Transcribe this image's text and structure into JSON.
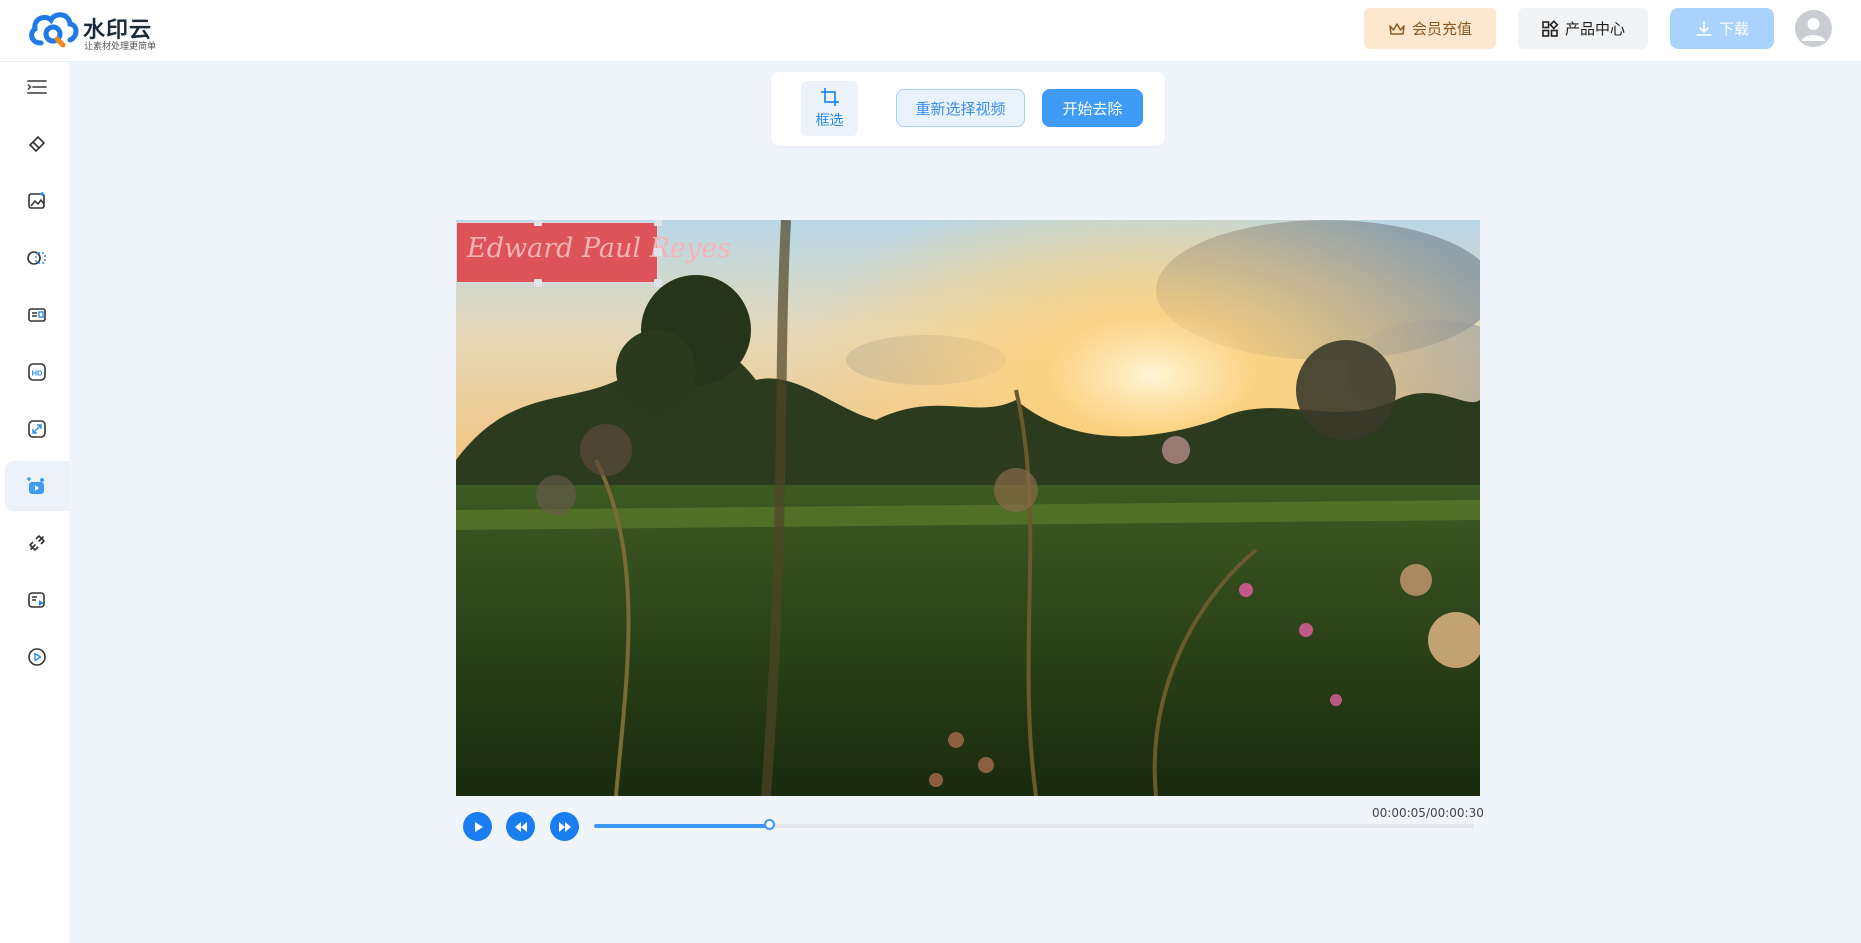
{
  "app": {
    "logo_title": "水印云",
    "logo_subtitle": "让素材处理更简单"
  },
  "header": {
    "vip_label": "会员充值",
    "products_label": "产品中心",
    "download_label": "下载"
  },
  "sidebar": {
    "items": [
      {
        "icon": "menu-collapse-icon"
      },
      {
        "icon": "eraser-icon"
      },
      {
        "icon": "image-edit-icon"
      },
      {
        "icon": "cutout-icon"
      },
      {
        "icon": "id-photo-icon"
      },
      {
        "icon": "hd-icon"
      },
      {
        "icon": "image-resize-icon"
      },
      {
        "icon": "video-watermark-icon",
        "active": true
      },
      {
        "icon": "link-icon"
      },
      {
        "icon": "video-edit-icon"
      },
      {
        "icon": "play-circle-icon"
      }
    ]
  },
  "toolbar": {
    "select_label": "框选",
    "reselect_label": "重新选择视频",
    "start_label": "开始去除"
  },
  "video": {
    "watermark_text": "Edward Paul Reyes"
  },
  "player": {
    "time_label": "00:00:05/00:00:30",
    "progress_fraction": 0.2
  },
  "colors": {
    "accent": "#3e9cf6",
    "vip_bg": "#fde8cf",
    "page_bg": "#f0f4fb"
  }
}
